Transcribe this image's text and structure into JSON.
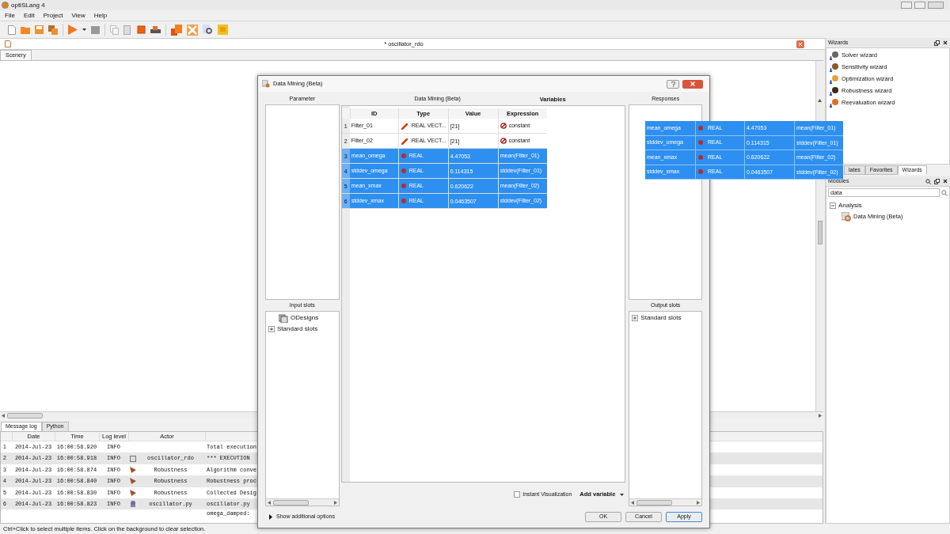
{
  "window": {
    "title": "optiSLang 4"
  },
  "menu": [
    {
      "label": "File"
    },
    {
      "label": "Edit"
    },
    {
      "label": "Project"
    },
    {
      "label": "View"
    },
    {
      "label": "Help"
    }
  ],
  "document_tab": {
    "title": "* oscillator_rdo"
  },
  "view_tabs": [
    {
      "label": "Scenery",
      "selected": true
    }
  ],
  "wizards_panel": {
    "title": "Wizards",
    "items": [
      {
        "label": "Solver wizard",
        "kind": "solver"
      },
      {
        "label": "Sensitivity wizard",
        "kind": "sensitivity"
      },
      {
        "label": "Optimization wizard",
        "kind": "optimization"
      },
      {
        "label": "Robustness wizard",
        "kind": "robustness"
      },
      {
        "label": "Reevaluation wizard",
        "kind": "reevaluation"
      }
    ]
  },
  "side_tabs": [
    {
      "label": "lates",
      "selected": false
    },
    {
      "label": "Favorites",
      "selected": false
    },
    {
      "label": "Wizards",
      "selected": true
    }
  ],
  "modules_panel": {
    "title": "Modules",
    "search": "data",
    "tree": [
      {
        "label": "Analysis",
        "expanded": true,
        "children": [
          {
            "label": "Data Mining (Beta)"
          }
        ]
      }
    ]
  },
  "log_tabs": [
    {
      "label": "Message log",
      "selected": true
    },
    {
      "label": "Python",
      "selected": false
    }
  ],
  "log_table": {
    "columns": [
      "Date",
      "Time",
      "Log level",
      "Actor"
    ],
    "rows": [
      {
        "index": "1",
        "date": "2014-Jul-23",
        "time": "16:00:58.920",
        "level": "INFO",
        "actor": "",
        "kind": "none",
        "message": "Total execution"
      },
      {
        "index": "2",
        "date": "2014-Jul-23",
        "time": "16:00:58.918",
        "level": "INFO",
        "actor": "oscillator_rdo",
        "kind": "project",
        "message": "*** EXECUTION"
      },
      {
        "index": "3",
        "date": "2014-Jul-23",
        "time": "16:00:58.874",
        "level": "INFO",
        "actor": "Robustness",
        "kind": "algorithm",
        "message": "Algorithm conve"
      },
      {
        "index": "4",
        "date": "2014-Jul-23",
        "time": "16:00:58.840",
        "level": "INFO",
        "actor": "Robustness",
        "kind": "algorithm",
        "message": "Robustness proc"
      },
      {
        "index": "5",
        "date": "2014-Jul-23",
        "time": "16:00:58.830",
        "level": "INFO",
        "actor": "Robustness",
        "kind": "algorithm",
        "message": "Collected Desig"
      },
      {
        "index": "6",
        "date": "2014-Jul-23",
        "time": "16:00:58.823",
        "level": "INFO",
        "actor": "oscillator.py",
        "kind": "script",
        "message": "oscillator.py"
      }
    ],
    "continuation": "omega_damped:"
  },
  "status_bar": "Ctrl+Click to select multiple items. Click on the background to clear selection.",
  "dialog": {
    "title": "Data Mining (Beta)",
    "parameter_label": "Parameter",
    "input_slots": {
      "label": "Input slots",
      "tree": [
        {
          "label": "ODesigns",
          "kind": "designs"
        },
        {
          "label": "Standard slots",
          "kind": "group",
          "expanded": false
        }
      ]
    },
    "center_label": "Data Mining (Beta)",
    "variables_label": "Variables",
    "variables": {
      "columns": [
        "ID",
        "Type",
        "Value",
        "Expression"
      ],
      "rows": [
        {
          "index": "1",
          "id": "Filter_01",
          "kind": "vector",
          "type": "REAL VECT...",
          "value": "[21]",
          "expression": "constant",
          "selected": false
        },
        {
          "index": "2",
          "id": "Filter_02",
          "kind": "vector",
          "type": "REAL VECT...",
          "value": "[21]",
          "expression": "constant",
          "selected": false
        },
        {
          "index": "3",
          "id": "mean_omega",
          "kind": "scalar",
          "type": "REAL",
          "value": "4.47053",
          "expression": "mean(Filter_01)",
          "selected": true
        },
        {
          "index": "4",
          "id": "stddev_omega",
          "kind": "scalar",
          "type": "REAL",
          "value": "0.114315",
          "expression": "stddev(Filter_01)",
          "selected": true
        },
        {
          "index": "5",
          "id": "mean_xmax",
          "kind": "scalar",
          "type": "REAL",
          "value": "0.620622",
          "expression": "mean(Filter_02)",
          "selected": true
        },
        {
          "index": "6",
          "id": "stddev_xmax",
          "kind": "scalar",
          "type": "REAL",
          "value": "0.0463507",
          "expression": "stddev(Filter_02)",
          "selected": true
        }
      ]
    },
    "responses_label": "Responses",
    "output_slots": {
      "label": "Output slots",
      "tree": [
        {
          "label": "Standard slots",
          "kind": "group",
          "expanded": false
        }
      ]
    },
    "instant_visualization": {
      "label": "Instant Visualization",
      "checked": false
    },
    "add_variable": "Add variable",
    "show_options": "Show additional options",
    "buttons": [
      {
        "label": "OK",
        "default": false
      },
      {
        "label": "Cancel",
        "default": false
      },
      {
        "label": "Apply",
        "default": true
      }
    ]
  },
  "drag_preview": {
    "rows": [
      {
        "id": "mean_omega",
        "type": "REAL",
        "value": "4.47053",
        "expression": "mean(Filter_01)"
      },
      {
        "id": "stddev_omega",
        "type": "REAL",
        "value": "0.114315",
        "expression": "stddev(Filter_01)"
      },
      {
        "id": "mean_xmax",
        "type": "REAL",
        "value": "0.620622",
        "expression": "mean(Filter_02)"
      },
      {
        "id": "stddev_xmax",
        "type": "REAL",
        "value": "0.0463507",
        "expression": "stddev(Filter_02)"
      }
    ]
  }
}
